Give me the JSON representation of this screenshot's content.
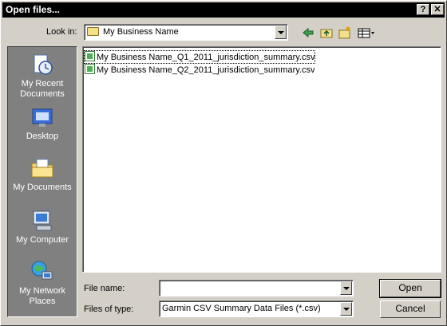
{
  "dialog": {
    "title": "Open files...",
    "help_glyph": "?",
    "close_glyph": "✕"
  },
  "lookin": {
    "label": "Look in:",
    "value": "My Business Name"
  },
  "toolbar": {
    "back_icon": "back-arrow-icon",
    "up_icon": "up-folder-icon",
    "new_folder_icon": "new-folder-icon",
    "view_icon": "view-menu-icon"
  },
  "places": [
    {
      "line1": "My Recent",
      "line2": "Documents",
      "icon": "recent-documents-icon"
    },
    {
      "line1": "Desktop",
      "line2": "",
      "icon": "desktop-icon"
    },
    {
      "line1": "My Documents",
      "line2": "",
      "icon": "my-documents-icon"
    },
    {
      "line1": "My Computer",
      "line2": "",
      "icon": "my-computer-icon"
    },
    {
      "line1": "My Network",
      "line2": "Places",
      "icon": "network-places-icon"
    }
  ],
  "files": [
    {
      "name": "My Business Name_Q1_2011_jurisdiction_summary.csv"
    },
    {
      "name": "My Business Name_Q2_2011_jurisdiction_summary.csv"
    }
  ],
  "filename": {
    "label": "File name:",
    "value": ""
  },
  "filetype": {
    "label": "Files of type:",
    "value": "Garmin CSV Summary Data Files (*.csv)"
  },
  "buttons": {
    "open": "Open",
    "cancel": "Cancel"
  }
}
